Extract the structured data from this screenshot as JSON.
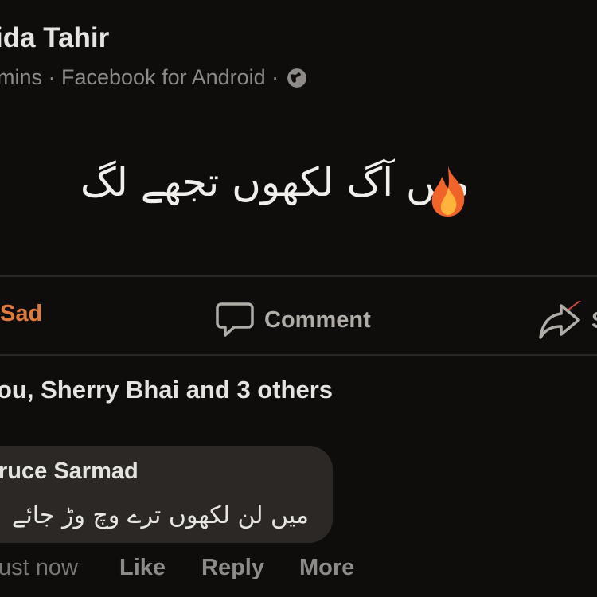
{
  "post": {
    "author": "ida Tahir",
    "meta": "mins · Facebook for Android ·",
    "text": "میں آگ لکھوں تجھے لگ"
  },
  "actions": {
    "reaction_label": "Sad",
    "comment_label": "Comment",
    "share_label": "S"
  },
  "reactions_summary": "ou, Sherry Bhai and 3 others",
  "comment": {
    "author": "ruce Sarmad",
    "text": "میں لن لکھوں ترے وچ وڑ جائے",
    "time": "ust now",
    "like_label": "Like",
    "reply_label": "Reply",
    "more_label": "More"
  },
  "icons": {
    "globe": "globe-icon",
    "flame": "fire-emoji-icon",
    "comment": "speech-bubble-icon",
    "share": "share-arrow-icon"
  },
  "colors": {
    "background": "#0f0d0c",
    "sad_orange": "#e07a3a",
    "muted_text": "#8d8a87",
    "bubble": "#2b2826"
  }
}
